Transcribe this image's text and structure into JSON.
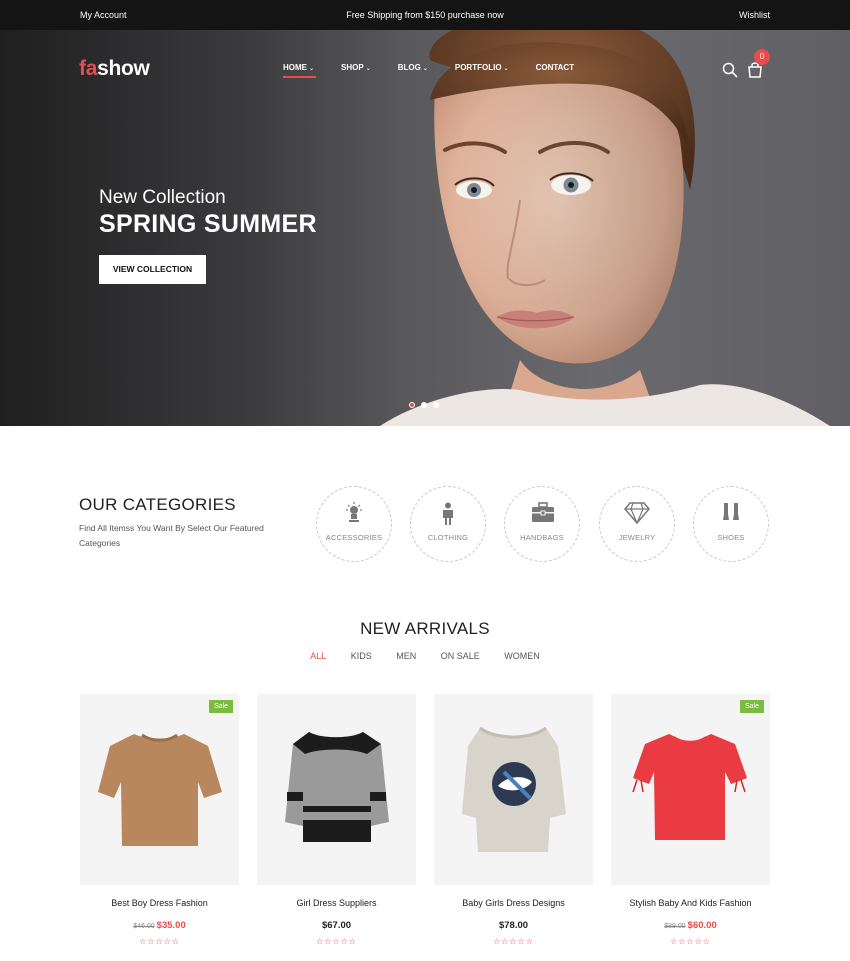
{
  "topbar": {
    "account": "My Account",
    "shipping": "Free Shipping from $150 purchase now",
    "wishlist": "Wishlist"
  },
  "header": {
    "logo_accent": "fa",
    "logo_rest": "show",
    "nav": [
      {
        "label": "HOME",
        "chevron": true,
        "active": true
      },
      {
        "label": "SHOP",
        "chevron": true,
        "active": false
      },
      {
        "label": "BLOG",
        "chevron": true,
        "active": false
      },
      {
        "label": "PORTFOLIO",
        "chevron": true,
        "active": false
      },
      {
        "label": "CONTACT",
        "chevron": false,
        "active": false
      }
    ],
    "cart_count": "0",
    "icons": [
      "search-icon",
      "cart-icon"
    ]
  },
  "hero": {
    "subtitle": "New Collection",
    "title": "SPRING SUMMER",
    "button": "VIEW COLLECTION",
    "slides": 3,
    "active_slide": 1
  },
  "categories": {
    "title": "OUR CATEGORIES",
    "description": "Find All Itemss You Want By Select Our Featured Categories",
    "items": [
      {
        "label": "ACCESSORIES",
        "icon": "lamp-icon"
      },
      {
        "label": "CLOTHING",
        "icon": "person-icon"
      },
      {
        "label": "HANDBAGS",
        "icon": "briefcase-icon"
      },
      {
        "label": "JEWELRY",
        "icon": "diamond-icon"
      },
      {
        "label": "SHOES",
        "icon": "shoes-icon"
      }
    ]
  },
  "arrivals": {
    "title": "NEW ARRIVALS",
    "filters": [
      "ALL",
      "KIDS",
      "MEN",
      "ON SALE",
      "WOMEN"
    ],
    "active_filter": "ALL",
    "products": [
      {
        "name": "Best Boy Dress Fashion",
        "old_price": "$46.00",
        "price": "$35.00",
        "sale": true,
        "badge": "Sale",
        "stars": "☆☆☆☆☆"
      },
      {
        "name": "Girl Dress Suppliers",
        "old_price": "",
        "price": "$67.00",
        "sale": false,
        "badge": "",
        "stars": "☆☆☆☆☆"
      },
      {
        "name": "Baby Girls Dress Designs",
        "old_price": "",
        "price": "$78.00",
        "sale": false,
        "badge": "",
        "stars": "☆☆☆☆☆"
      },
      {
        "name": "Stylish Baby And Kids Fashion",
        "old_price": "$89.00",
        "price": "$60.00",
        "sale": true,
        "badge": "Sale",
        "stars": "☆☆☆☆☆"
      }
    ]
  },
  "colors": {
    "accent": "#e84c4c",
    "sale_badge": "#7cbb3f",
    "topbar": "#141414"
  }
}
